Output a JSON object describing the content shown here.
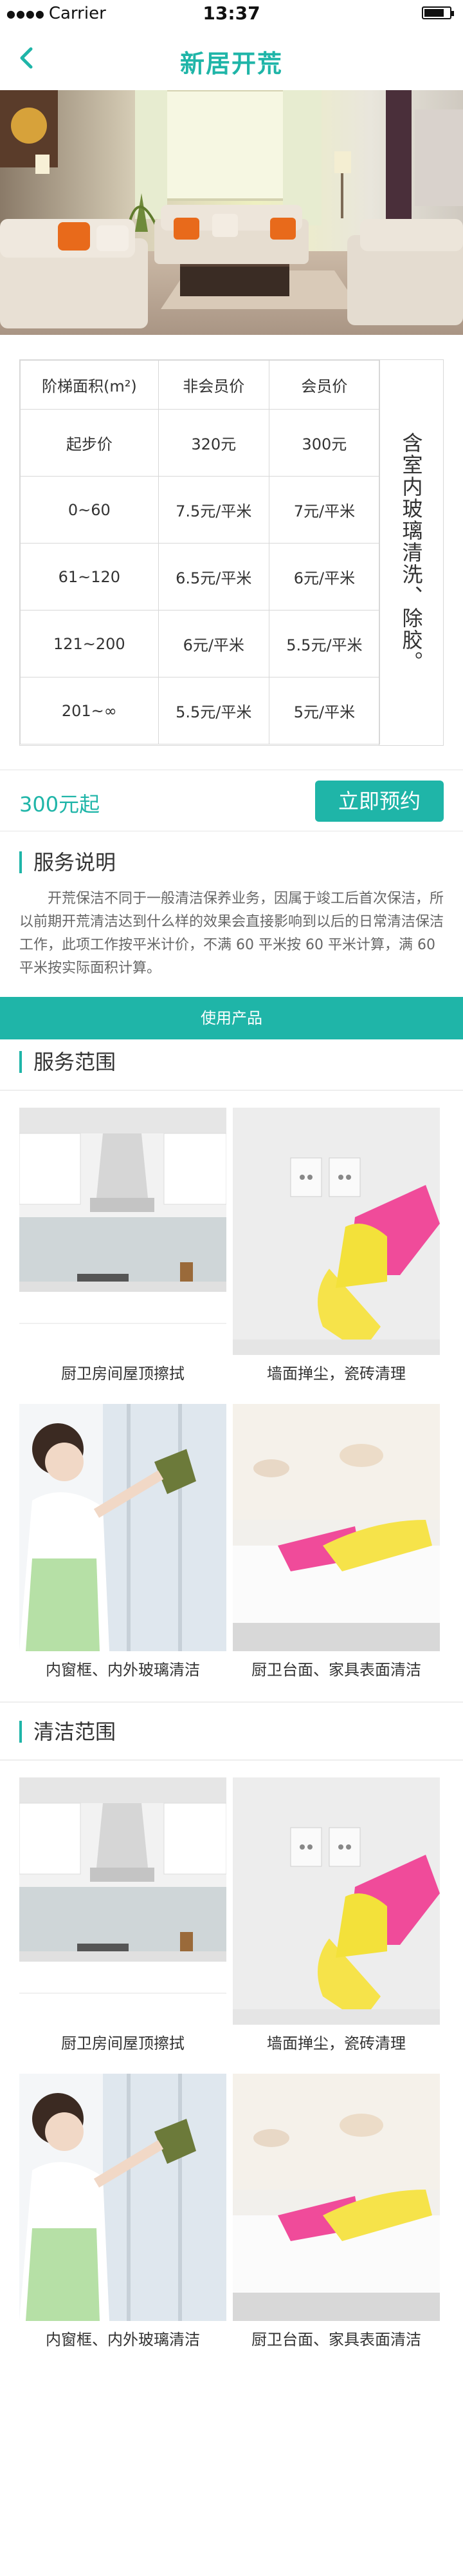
{
  "status_bar": {
    "carrier": "Carrier",
    "signal": "●●●●",
    "time": "13:37"
  },
  "nav": {
    "title": "新居开荒"
  },
  "price_table": {
    "headers": [
      "阶梯面积(m²)",
      "非会员价",
      "会员价"
    ],
    "rows": [
      [
        "起步价",
        "320元",
        "300元"
      ],
      [
        "0~60",
        "7.5元/平米",
        "7元/平米"
      ],
      [
        "61~120",
        "6.5元/平米",
        "6元/平米"
      ],
      [
        "121~200",
        "6元/平米",
        "5.5元/平米"
      ],
      [
        "201~∞",
        "5.5元/平米",
        "5元/平米"
      ]
    ],
    "side_note": "含室内玻璃清洗、除胶。"
  },
  "booking": {
    "price_from": "300元起",
    "button_label": "立即预约"
  },
  "service_desc": {
    "title": "服务说明",
    "text": "开荒保洁不同于一般清洁保养业务，因属于竣工后首次保洁，所以前期开荒清洁达到什么样的效果会直接影响到以后的日常清洁保洁工作，此项工作按平米计价，不满 60 平米按 60 平米计算，满 60 平米按实际面积计算。"
  },
  "product_bar": {
    "label": "使用产品"
  },
  "service_scope": {
    "title": "服务范围",
    "items": [
      {
        "caption": "厨卫房间屋顶擦拭"
      },
      {
        "caption": "墙面掸尘，瓷砖清理"
      },
      {
        "caption": "内窗框、内外玻璃清洁"
      },
      {
        "caption": "厨卫台面、家具表面清洁"
      }
    ]
  },
  "clean_scope": {
    "title": "清洁范围",
    "items": [
      {
        "caption": "厨卫房间屋顶擦拭"
      },
      {
        "caption": "墙面掸尘，瓷砖清理"
      },
      {
        "caption": "内窗框、内外玻璃清洁"
      },
      {
        "caption": "厨卫台面、家具表面清洁"
      }
    ]
  },
  "colors": {
    "accent": "#1fb5a8"
  },
  "icons": {
    "back": "chevron-left-icon",
    "battery": "battery-icon"
  }
}
